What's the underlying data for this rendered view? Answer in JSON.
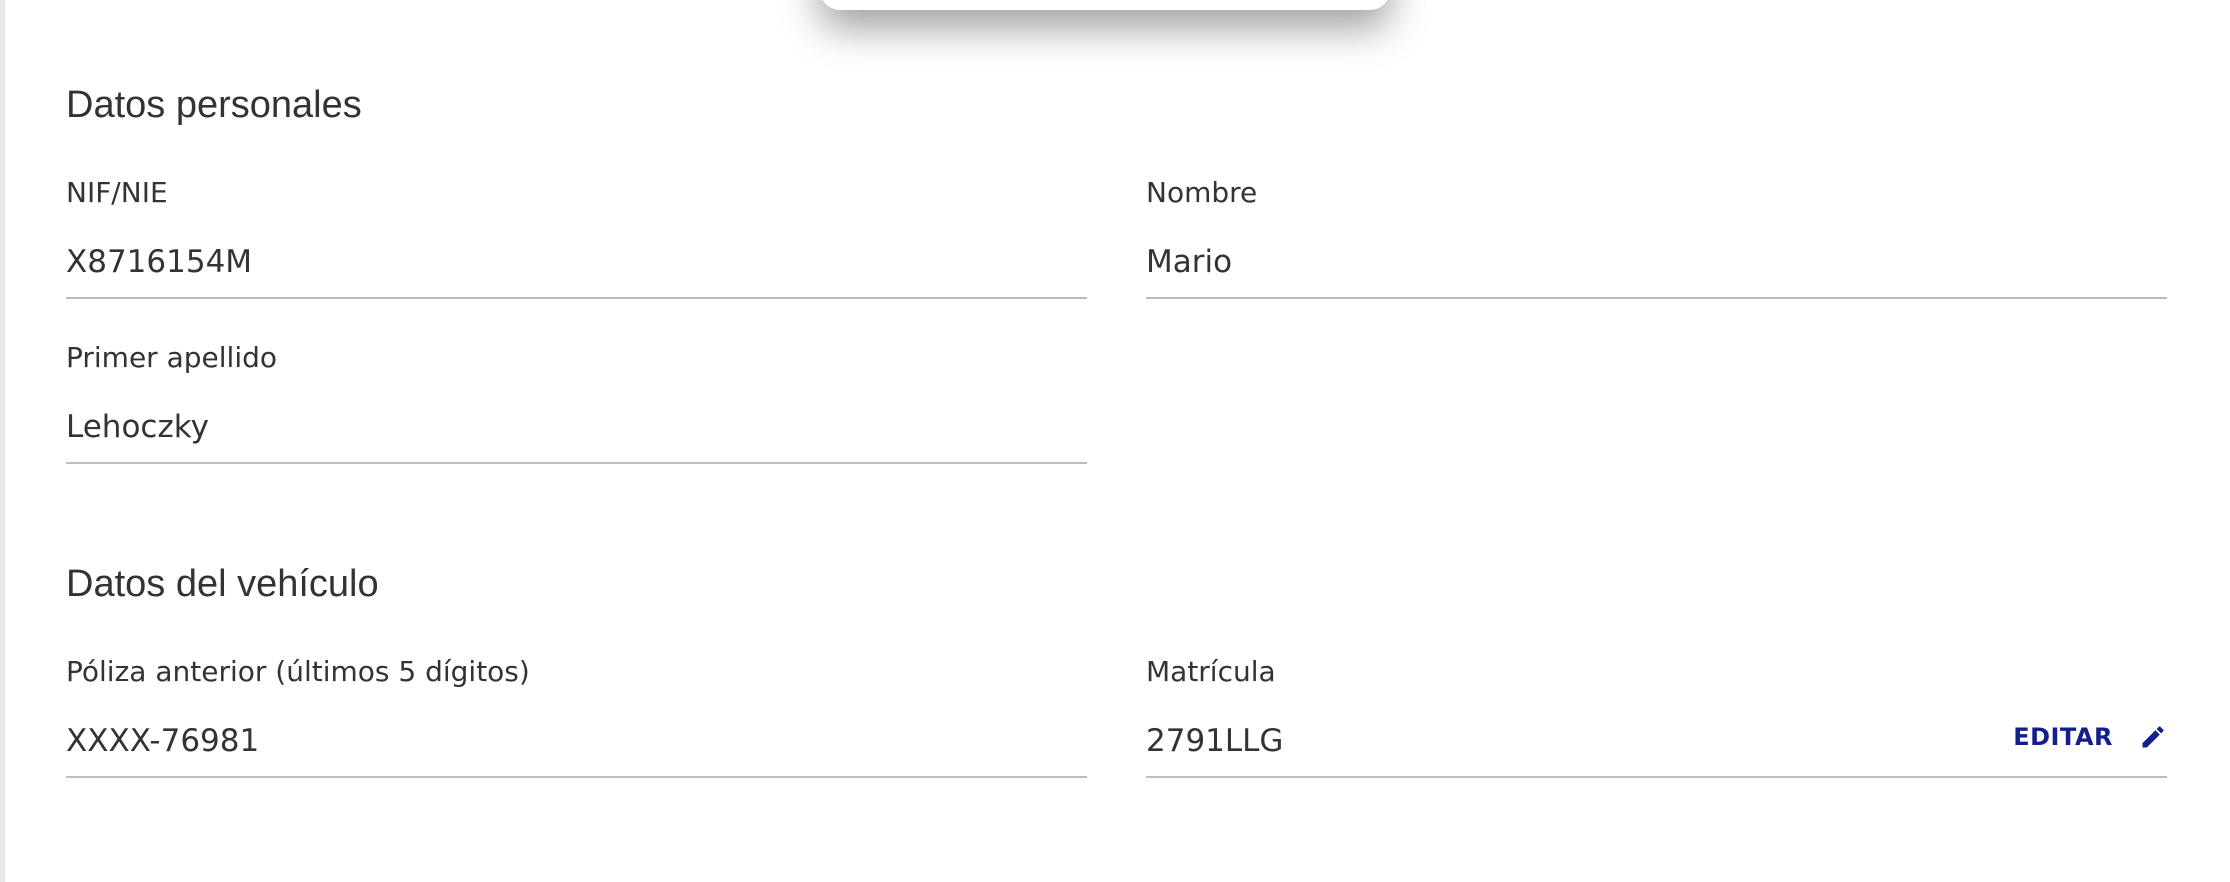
{
  "sections": {
    "personal": {
      "title": "Datos personales",
      "fields": {
        "nif": {
          "label": "NIF/NIE",
          "value": "X8716154M"
        },
        "nombre": {
          "label": "Nombre",
          "value": "Mario"
        },
        "apellido": {
          "label": "Primer apellido",
          "value": "Lehoczky"
        }
      }
    },
    "vehicle": {
      "title": "Datos del vehículo",
      "fields": {
        "poliza": {
          "label": "Póliza anterior (últimos 5 dígitos)",
          "value": "XXXX-76981"
        },
        "matricula": {
          "label": "Matrícula",
          "value": "2791LLG",
          "edit_label": "EDITAR"
        }
      }
    }
  },
  "colors": {
    "text": "#333333",
    "accent": "#141e8c",
    "underline": "#bdbdbd"
  },
  "icons": {
    "edit": "pencil-icon"
  }
}
